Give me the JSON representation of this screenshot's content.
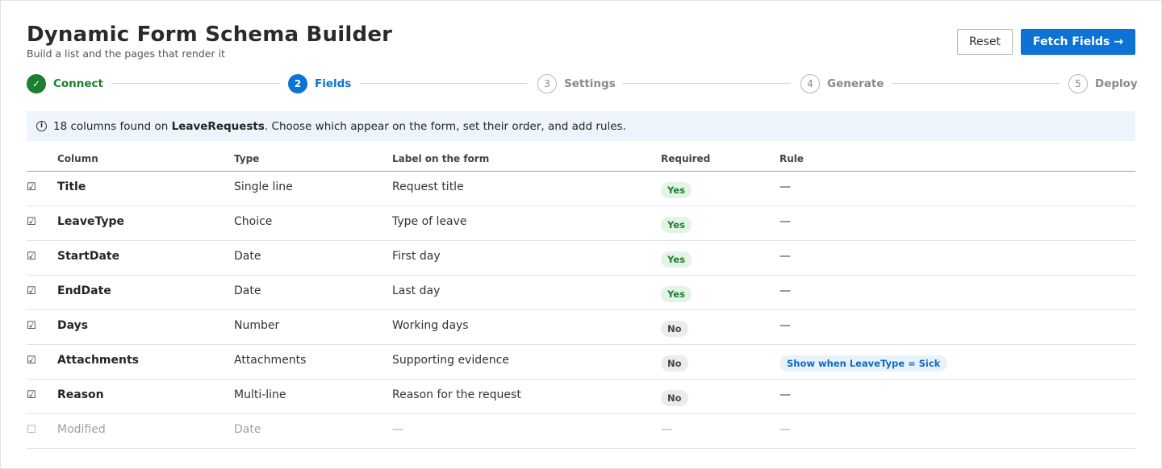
{
  "header": {
    "title": "Dynamic Form Schema Builder",
    "subtitle": "Build a list and the pages that render it",
    "reset_label": "Reset",
    "fetch_label": "Fetch Fields →"
  },
  "stepper": [
    {
      "number": "✓",
      "label": "Connect",
      "state": "done"
    },
    {
      "number": "2",
      "label": "Fields",
      "state": "active"
    },
    {
      "number": "3",
      "label": "Settings",
      "state": "pending"
    },
    {
      "number": "4",
      "label": "Generate",
      "state": "pending"
    },
    {
      "number": "5",
      "label": "Deploy",
      "state": "pending"
    }
  ],
  "info": {
    "icon": "info-icon",
    "prefix": "18 columns found on ",
    "list_name": "LeaveRequests",
    "suffix": ". Choose which appear on the form, set their order, and add rules."
  },
  "table": {
    "headers": {
      "column": "Column",
      "type": "Type",
      "label": "Label on the form",
      "required": "Required",
      "rule": "Rule"
    },
    "rows": [
      {
        "checked": "☑",
        "column": "Title",
        "type": "Single line",
        "label": "Request title",
        "required": "Yes",
        "rule": "—"
      },
      {
        "checked": "☑",
        "column": "LeaveType",
        "type": "Choice",
        "label": "Type of leave",
        "required": "Yes",
        "rule": "—"
      },
      {
        "checked": "☑",
        "column": "StartDate",
        "type": "Date",
        "label": "First day",
        "required": "Yes",
        "rule": "—"
      },
      {
        "checked": "☑",
        "column": "EndDate",
        "type": "Date",
        "label": "Last day",
        "required": "Yes",
        "rule": "—"
      },
      {
        "checked": "☑",
        "column": "Days",
        "type": "Number",
        "label": "Working days",
        "required": "No",
        "rule": "—"
      },
      {
        "checked": "☑",
        "column": "Attachments",
        "type": "Attachments",
        "label": "Supporting evidence",
        "required": "No",
        "rule": "Show when LeaveType = Sick"
      },
      {
        "checked": "☑",
        "column": "Reason",
        "type": "Multi-line",
        "label": "Reason for the request",
        "required": "No",
        "rule": "—"
      },
      {
        "checked": "☐",
        "column": "Modified",
        "type": "Date",
        "label": "—",
        "required": "—",
        "rule": "—"
      }
    ]
  },
  "colors": {
    "accent": "#0c73d4",
    "success": "#1a7f2e",
    "info_bg": "#edf4fb"
  }
}
